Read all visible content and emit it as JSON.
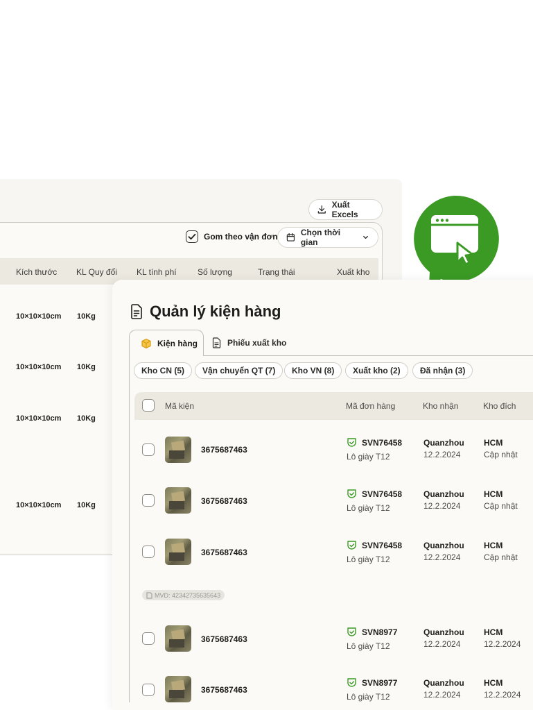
{
  "back": {
    "export_label": "Xuất Excels",
    "group_label": "Gom theo vận đơn",
    "time_label": "Chọn thời gian",
    "headers": [
      "Kích thước",
      "KL Quy đổi",
      "KL tính phí",
      "Số lượng",
      "Trạng thái",
      "Xuất kho"
    ],
    "rows": [
      {
        "size": "10×10×10cm",
        "weight": "10Kg"
      },
      {
        "size": "10×10×10cm",
        "weight": "10Kg"
      },
      {
        "size": "10×10×10cm",
        "weight": "10Kg"
      },
      {
        "size": "10×10×10cm",
        "weight": "10Kg"
      }
    ]
  },
  "front": {
    "title": "Quản lý kiện hàng",
    "tabs": [
      {
        "label": "Kiện hàng",
        "active": true
      },
      {
        "label": "Phiếu xuất kho",
        "active": false
      }
    ],
    "filters": [
      "Kho CN (5)",
      "Vận chuyển QT (7)",
      "Kho VN (8)",
      "Xuất kho (2)",
      "Đã nhận (3)"
    ],
    "headers": [
      "Mã kiện",
      "Mã đơn hàng",
      "Kho nhận",
      "Kho đích"
    ],
    "rows": [
      {
        "code": "3675687463",
        "order": "SVN76458",
        "note": "Lô giày T12",
        "warehouse": "Quanzhou",
        "date": "12.2.2024",
        "dest": "HCM",
        "dest_sub": "Cập nhật"
      },
      {
        "code": "3675687463",
        "order": "SVN76458",
        "note": "Lô giày T12",
        "warehouse": "Quanzhou",
        "date": "12.2.2024",
        "dest": "HCM",
        "dest_sub": "Cập nhật"
      },
      {
        "code": "3675687463",
        "order": "SVN76458",
        "note": "Lô giày T12",
        "warehouse": "Quanzhou",
        "date": "12.2.2024",
        "dest": "HCM",
        "dest_sub": "Cập nhật"
      },
      {
        "code": "3675687463",
        "order": "SVN8977",
        "note": "Lô giày T12",
        "warehouse": "Quanzhou",
        "date": "12.2.2024",
        "dest": "HCM",
        "dest_sub": "12.2.2024"
      },
      {
        "code": "3675687463",
        "order": "SVN8977",
        "note": "Lô giày T12",
        "warehouse": "Quanzhou",
        "date": "12.2.2024",
        "dest": "HCM",
        "dest_sub": "12.2.2024"
      }
    ],
    "mvd_label": "MVD: 42342735635643"
  },
  "colors": {
    "accent": "#3a9a24",
    "header_bg": "#ece9e1",
    "panel_bg": "#fbfaf7"
  },
  "icons": {
    "logo": "browser-cursor-icon",
    "export": "download-icon",
    "title": "document-icon",
    "tab_active": "box-icon",
    "tab_inactive": "document-icon",
    "order": "shield-check-icon"
  }
}
